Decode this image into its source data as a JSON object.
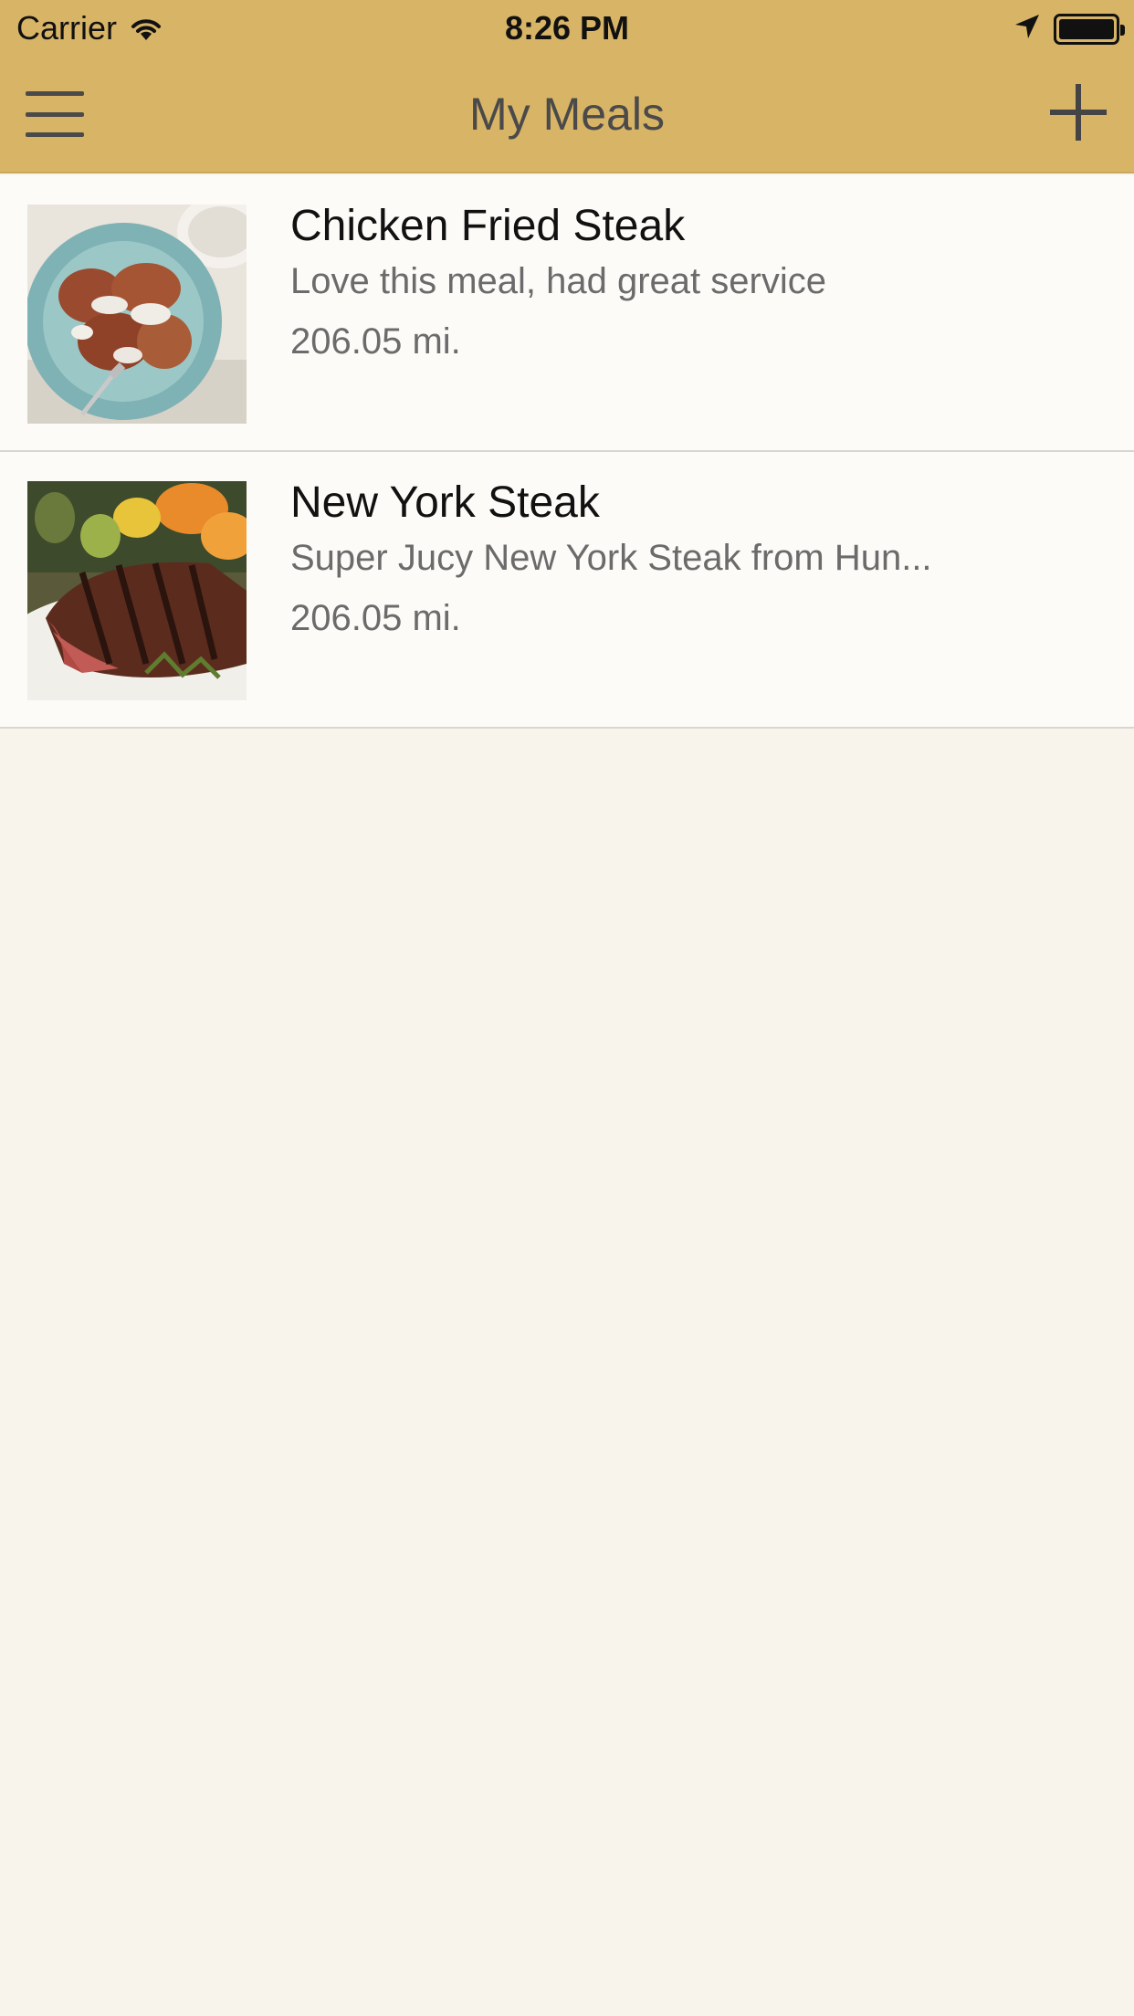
{
  "status_bar": {
    "carrier": "Carrier",
    "time": "8:26 PM",
    "wifi_icon": "wifi-icon",
    "location_icon": "location-arrow-icon",
    "battery_icon": "battery-icon"
  },
  "nav": {
    "title": "My Meals",
    "menu_icon": "hamburger-menu-icon",
    "add_icon": "plus-icon"
  },
  "meals": [
    {
      "name": "Chicken Fried Steak",
      "description": "Love this meal, had great service",
      "distance": "206.05 mi.",
      "image_icon": "chicken-fried-steak-photo"
    },
    {
      "name": "New York Steak",
      "description": "Super Jucy New York Steak from Hun...",
      "distance": "206.05 mi.",
      "image_icon": "new-york-steak-photo"
    }
  ],
  "colors": {
    "nav_background": "#d8b466",
    "page_background": "#f8f4ec",
    "row_background": "#fdfbf8",
    "title_text": "#4a4a4a",
    "secondary_text": "#6b6b6b"
  }
}
